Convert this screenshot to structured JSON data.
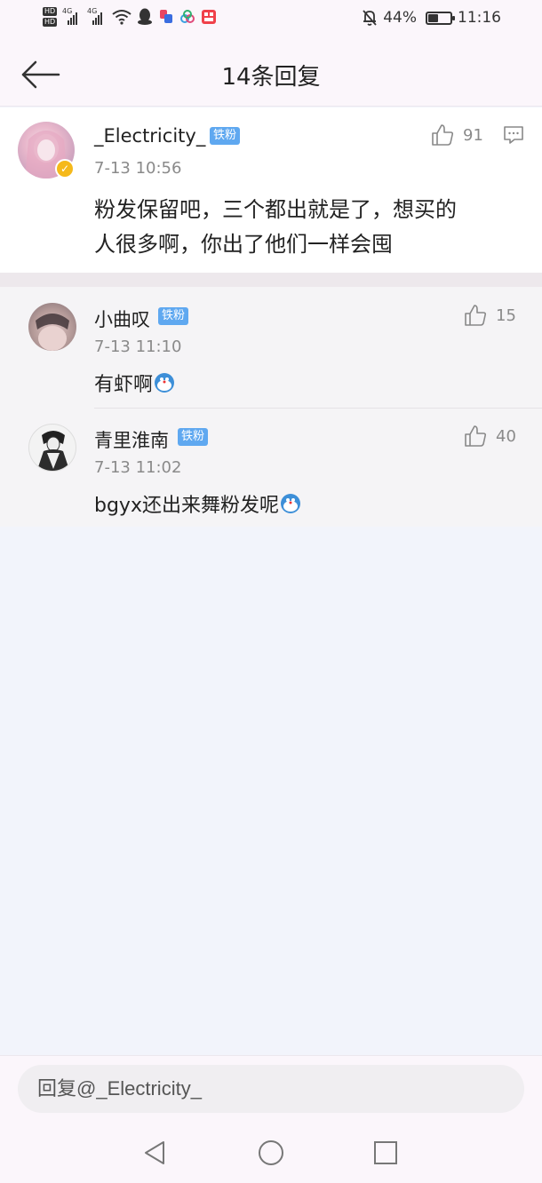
{
  "status_bar": {
    "hd1": "HD",
    "hd2": "HD",
    "net1": "4G",
    "net2": "4G",
    "battery_percent_text": "44%",
    "battery_level": 0.44,
    "time": "11:16"
  },
  "header": {
    "title": "14条回复"
  },
  "main_comment": {
    "username": "_Electricity_",
    "badge": "铁粉",
    "time": "7-13 10:56",
    "likes": "91",
    "text_line1": "粉发保留吧，三个都出就是了，想买的",
    "text_line2": "人很多啊，你出了他们一样会囤"
  },
  "replies": [
    {
      "username": "小曲叹",
      "badge": "铁粉",
      "time": "7-13 11:10",
      "likes": "15",
      "text": "有虾啊"
    },
    {
      "username": "青里淮南",
      "badge": "铁粉",
      "time": "7-13 11:02",
      "likes": "40",
      "text": "bgyx还出来舞粉发呢"
    }
  ],
  "input": {
    "placeholder": "回复@_Electricity_"
  },
  "colors": {
    "badge_blue": "#5fa8f0",
    "verified_gold": "#f5b91b",
    "background": "#f2f4fb"
  },
  "icons": [
    "back-arrow-icon",
    "thumbs-up-icon",
    "reply-comment-icon",
    "emoji-icon",
    "nav-back-icon",
    "nav-home-icon",
    "nav-recents-icon"
  ]
}
